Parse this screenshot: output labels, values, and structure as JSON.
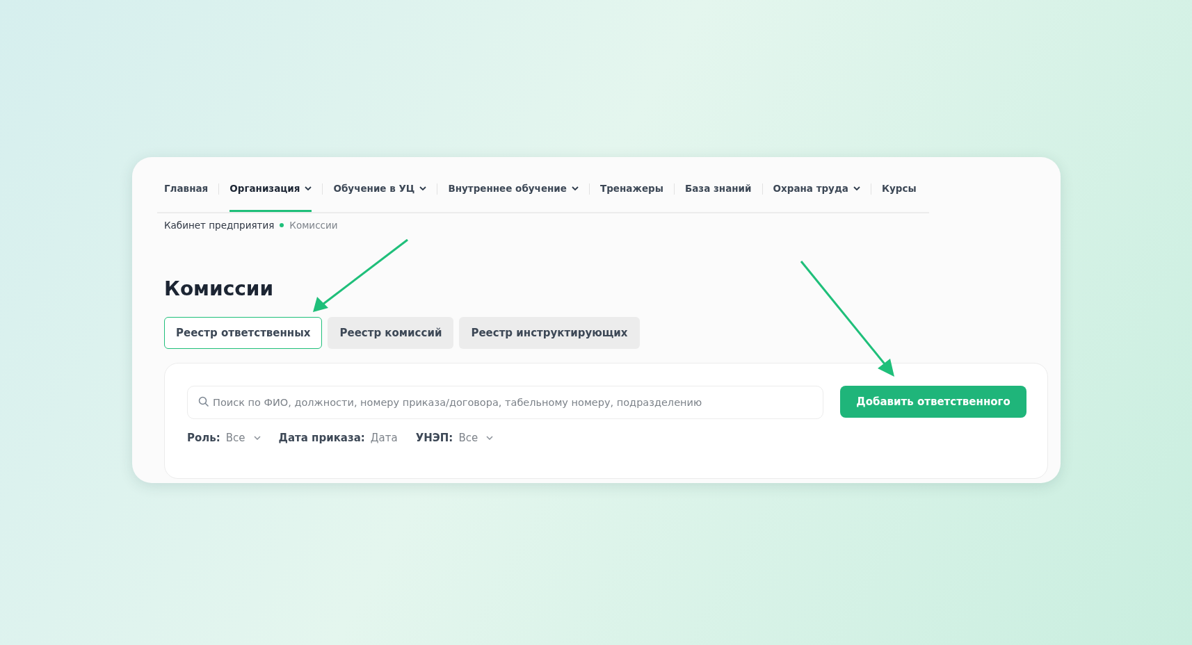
{
  "nav": [
    {
      "label": "Главная",
      "selected": false,
      "dropdown": false
    },
    {
      "label": "Организация",
      "selected": true,
      "dropdown": true
    },
    {
      "label": "Обучение в УЦ",
      "selected": false,
      "dropdown": true
    },
    {
      "label": "Внутреннее обучение",
      "selected": false,
      "dropdown": true
    },
    {
      "label": "Тренажеры",
      "selected": false,
      "dropdown": false
    },
    {
      "label": "База знаний",
      "selected": false,
      "dropdown": false
    },
    {
      "label": "Охрана труда",
      "selected": false,
      "dropdown": true
    },
    {
      "label": "Курсы",
      "selected": false,
      "dropdown": false
    }
  ],
  "breadcrumb": [
    "Кабинет предприятия",
    "Комиссии"
  ],
  "title": "Комиссии",
  "tabs": [
    {
      "label": "Реестр ответственных",
      "selected": true
    },
    {
      "label": "Реестр комиссий",
      "selected": false
    },
    {
      "label": "Реестр инструктирующих",
      "selected": false
    }
  ],
  "search": {
    "placeholder": "Поиск по ФИО, должности, номеру приказа/договора, табельному номеру, подразделению"
  },
  "add_button": "Добавить ответственного",
  "filters": [
    {
      "label": "Роль:",
      "value": "Все",
      "dropdown": true
    },
    {
      "label": "Дата приказа:",
      "value": "Дата",
      "dropdown": false
    },
    {
      "label": "УНЭП:",
      "value": "Все",
      "dropdown": true
    }
  ]
}
